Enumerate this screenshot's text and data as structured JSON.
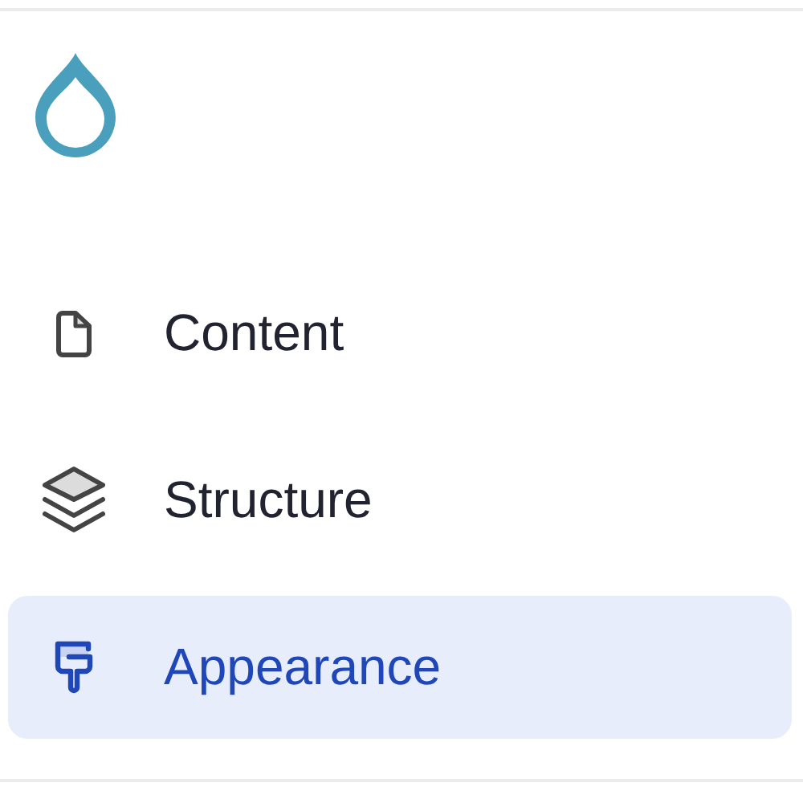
{
  "menu": {
    "items": [
      {
        "label": "Content",
        "kind": "document",
        "selected": false
      },
      {
        "label": "Structure",
        "kind": "layers",
        "selected": false
      },
      {
        "label": "Appearance",
        "kind": "brush",
        "selected": true
      }
    ]
  }
}
